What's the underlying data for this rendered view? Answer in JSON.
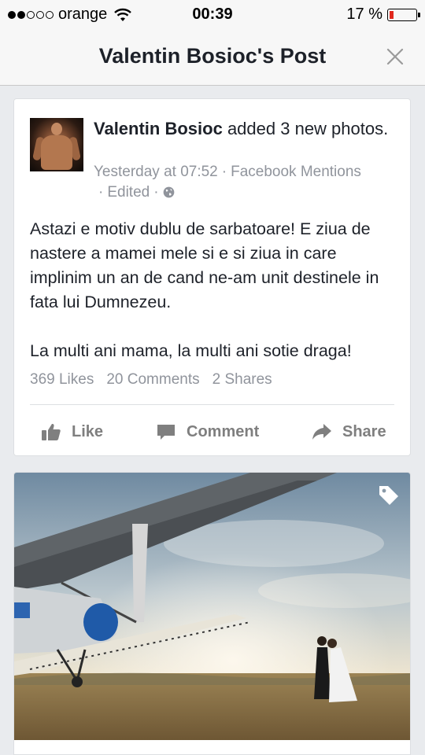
{
  "status_bar": {
    "carrier": "orange",
    "time": "00:39",
    "battery_text": "17 %",
    "battery_level": 0.17,
    "signal_bars_filled": 2,
    "signal_bars_total": 5
  },
  "header": {
    "title": "Valentin Bosioc's Post",
    "close_icon": "close-icon"
  },
  "post": {
    "author": "Valentin Bosioc",
    "action_text": " added 3 new photos.",
    "timestamp": "Yesterday at 07:52",
    "source": "Facebook Mentions",
    "edited": "Edited",
    "privacy_icon": "globe-icon",
    "text_paragraphs": [
      "Astazi e motiv dublu de sarbatoare! E ziua de nastere a mamei mele si e si ziua in care implinim un an de cand ne-am unit destinele in fata lui Dumnezeu.",
      "La multi ani mama, la multi ani sotie draga!"
    ],
    "likes": "369 Likes",
    "comments": "20 Comments",
    "shares": "2 Shares",
    "actions": {
      "like": "Like",
      "comment": "Comment",
      "share": "Share"
    }
  },
  "photo": {
    "tag_icon": "tag-icon"
  },
  "colors": {
    "battery_low": "#e0281e",
    "meta_gray": "#90949c",
    "action_gray": "#7f7f7f",
    "text_dark": "#1d2129"
  }
}
